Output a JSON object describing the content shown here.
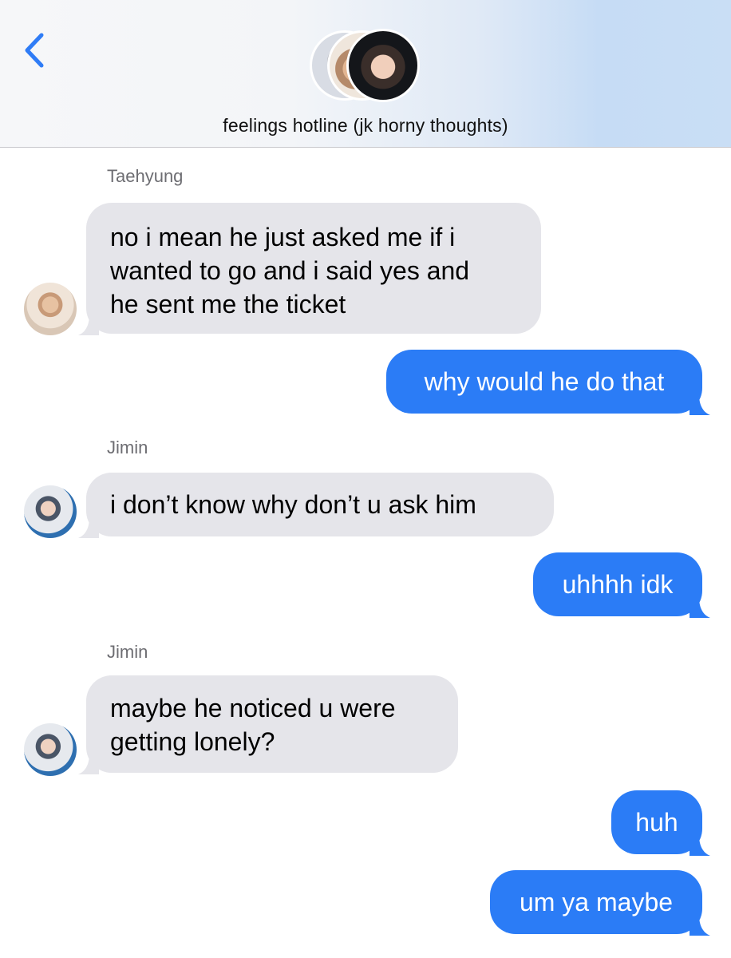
{
  "header": {
    "back_label": "<",
    "group_title": "feelings hotline (jk horny thoughts)"
  },
  "messages": [
    {
      "type": "incoming",
      "sender": "Taehyung",
      "lines": [
        "no i mean he just asked me if i",
        "wanted to go and i said yes and",
        "he sent me the ticket"
      ]
    },
    {
      "type": "outgoing",
      "text": "why would he do that"
    },
    {
      "type": "incoming",
      "sender": "Jimin",
      "lines": [
        "i don’t know why don’t u ask him"
      ]
    },
    {
      "type": "outgoing",
      "text": "uhhhh idk"
    },
    {
      "type": "incoming",
      "sender": "Jimin",
      "lines": [
        "maybe he noticed u were",
        "getting lonely?"
      ]
    },
    {
      "type": "outgoing",
      "text": "huh"
    },
    {
      "type": "outgoing",
      "text": "um ya maybe"
    }
  ],
  "colors": {
    "outgoing_bubble": "#2b7cf6",
    "incoming_bubble": "#e5e5ea",
    "back_chevron": "#2f7cf6"
  },
  "icons": [
    "chevron-left-icon"
  ]
}
